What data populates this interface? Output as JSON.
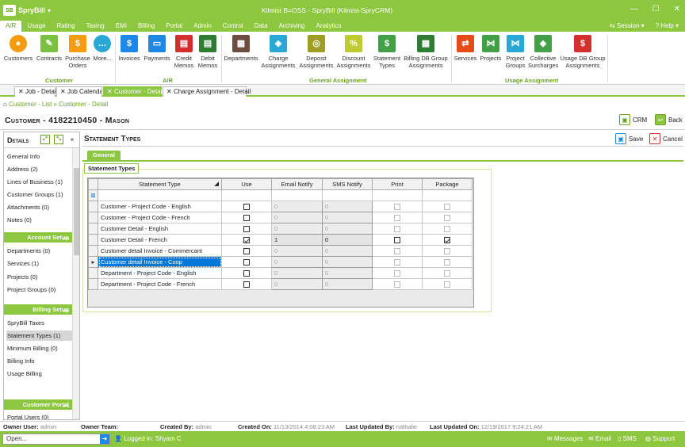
{
  "app": {
    "name": "SpryBill",
    "logo_text": "SB",
    "window_title": "Kilmist B=OSS - SpryBill (Kilmist-SpryCRM)"
  },
  "window_controls": {
    "minimize": "—",
    "maximize": "☐",
    "close": "✕"
  },
  "menu": [
    "A/R",
    "Usage",
    "Rating",
    "Taxing",
    "EMI",
    "Billing",
    "Portal",
    "Admin",
    "Control",
    "Data",
    "Archiving",
    "Analytics"
  ],
  "menu_right": {
    "session": "Session",
    "help": "Help"
  },
  "ribbon": {
    "buttons": [
      "Customers",
      "Contracts",
      "Purchase Orders",
      "More...",
      "Invoices",
      "Payments",
      "Credit Memos",
      "Debit Memos",
      "Departments",
      "Charge Assignments",
      "Deposit Assignments",
      "Discount Assignments",
      "Statement Types",
      "Billing DB Group Assignments",
      "Services",
      "Projects",
      "Project Groups",
      "Collective Surcharges",
      "Usage DB Group Assignments"
    ],
    "groups": [
      "Customer",
      "A/R",
      "General Assignment",
      "Usage Assignment"
    ]
  },
  "doc_tabs": [
    "Job - Detail",
    "Job Calendar",
    "Customer - Detail",
    "Charge Assignment - Detail"
  ],
  "breadcrumb": {
    "home": "⌂",
    "item1": "Customer - List",
    "sep": "»",
    "item2": "Customer - Detail"
  },
  "customer_title": "Customer - 4182210450 - Mason",
  "top_actions": {
    "crm": "CRM",
    "back": "Back"
  },
  "sidebar": {
    "header": "Details",
    "sections": [
      {
        "title": "",
        "items": [
          "General Info",
          "Address (2)",
          "Lines of Business (1)",
          "Customer Groups (1)",
          "Attachments (0)",
          "Notes (0)"
        ]
      },
      {
        "title": "Account Setup",
        "items": [
          "Departments (0)",
          "Services (1)",
          "Projects (0)",
          "Project Groups (0)"
        ]
      },
      {
        "title": "Billing Setup",
        "items": [
          "SpryBill Taxes",
          "Statement Types (1)",
          "Minimum Billing (0)",
          "Billing Info",
          "Usage Billing"
        ]
      },
      {
        "title": "Customer Portal",
        "items": [
          "Portal Users (0)"
        ]
      }
    ]
  },
  "section": {
    "title": "Statement Types",
    "save": "Save",
    "cancel": "Cancel",
    "tab": "General",
    "panel_title": "Statement Types"
  },
  "grid": {
    "columns": [
      "Statement Type",
      "Use",
      "Email Notify",
      "SMS Notify",
      "Print",
      "Package"
    ],
    "rows": [
      {
        "name": "Customer - Project Code - English",
        "use": false,
        "email": "0",
        "sms": "0",
        "print": false,
        "package": false
      },
      {
        "name": "Customer - Project Code - French",
        "use": false,
        "email": "0",
        "sms": "0",
        "print": false,
        "package": false
      },
      {
        "name": "Customer Detail - English",
        "use": false,
        "email": "0",
        "sms": "0",
        "print": false,
        "package": false
      },
      {
        "name": "Customer Detail - French",
        "use": true,
        "email": "1",
        "sms": "0",
        "print": false,
        "package": true
      },
      {
        "name": "Customer detail Invoice - Commercant",
        "use": false,
        "email": "0",
        "sms": "0",
        "print": false,
        "package": false
      },
      {
        "name": "Customer detail Invoice - Coop",
        "use": false,
        "email": "0",
        "sms": "0",
        "print": false,
        "package": false
      },
      {
        "name": "Department - Project Code - English",
        "use": false,
        "email": "0",
        "sms": "0",
        "print": false,
        "package": false
      },
      {
        "name": "Department - Project Code - French",
        "use": false,
        "email": "0",
        "sms": "0",
        "print": false,
        "package": false
      }
    ]
  },
  "status": {
    "owner_user_label": "Owner User:",
    "owner_user": "admin",
    "owner_team_label": "Owner Team:",
    "owner_team": "",
    "created_by_label": "Created By:",
    "created_by": "admin",
    "created_on_label": "Created On:",
    "created_on": "11/13/2014 4:08:23 AM",
    "updated_by_label": "Last Updated By:",
    "updated_by": "nathalie",
    "updated_on_label": "Last Updated On:",
    "updated_on": "12/19/2017 9:24:21 AM"
  },
  "bottom": {
    "open_placeholder": "Open...",
    "logged_in": "Logged in: Shyam C",
    "messages": "Messages",
    "email": "Email",
    "sms": "SMS",
    "support": "Support"
  },
  "colors": {
    "brand": "#8dc63f",
    "brand_dark": "#6aa321",
    "selection": "#0078d7"
  }
}
